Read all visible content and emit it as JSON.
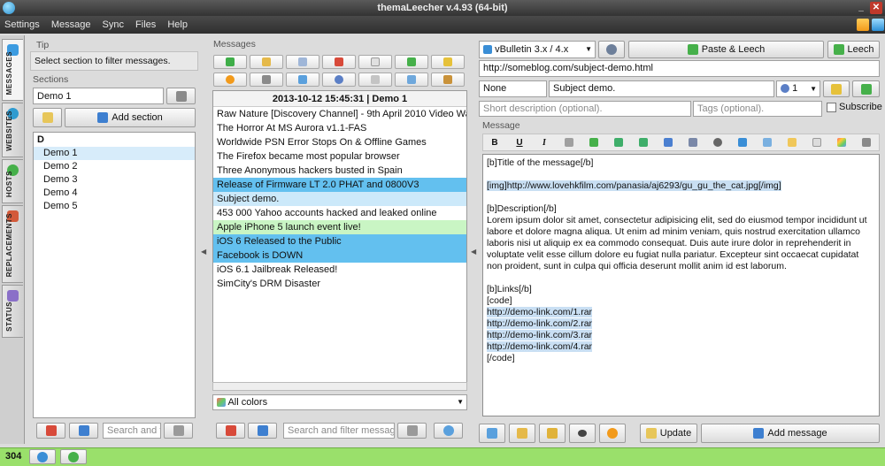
{
  "window": {
    "title": "themaLeecher v.4.93  (64-bit)"
  },
  "menu": [
    "Settings",
    "Message",
    "Sync",
    "Files",
    "Help"
  ],
  "side_tabs": [
    "MESSAGES",
    "WEBSITES",
    "HOSTS",
    "REPLACEMENTS",
    "STATUS"
  ],
  "left": {
    "tip_label": "Tip",
    "tip_text": "Select section to filter messages.",
    "sections_label": "Sections",
    "section_name": "Demo 1",
    "add_section": "Add section",
    "group": "D",
    "items": [
      "Demo 1",
      "Demo 2",
      "Demo 3",
      "Demo 4",
      "Demo 5"
    ],
    "search_placeholder": "Search and fil"
  },
  "messages": {
    "label": "Messages",
    "header": "2013-10-12 15:45:31 | Demo 1",
    "items": [
      {
        "text": "Raw Nature [Discovery Channel] - 9th April 2010 Video Watch Onli",
        "style": ""
      },
      {
        "text": "The Horror At MS Aurora v1.1-FAS",
        "style": ""
      },
      {
        "text": "Worldwide PSN Error Stops On & Offline Games",
        "style": ""
      },
      {
        "text": "The Firefox became most popular browser",
        "style": ""
      },
      {
        "text": "Three Anonymous hackers busted in Spain",
        "style": ""
      },
      {
        "text": "Release of Firmware LT 2.0 PHAT and 0800V3",
        "style": "blue"
      },
      {
        "text": "Subject demo.",
        "style": "light"
      },
      {
        "text": "453 000 Yahoo accounts hacked and leaked online",
        "style": ""
      },
      {
        "text": "Apple iPhone 5 launch event live!",
        "style": "green"
      },
      {
        "text": "iOS 6 Released to the Public",
        "style": "blue"
      },
      {
        "text": "Facebook is DOWN",
        "style": "blue"
      },
      {
        "text": "iOS 6.1 Jailbreak Released!",
        "style": ""
      },
      {
        "text": "SimCity's DRM Disaster",
        "style": ""
      }
    ],
    "color_filter": "All colors",
    "search_placeholder": "Search and filter messages."
  },
  "right": {
    "platform": "vBulletin 3.x / 4.x",
    "paste_leech": "Paste & Leech",
    "leech": "Leech",
    "url": "http://someblog.com/subject-demo.html",
    "prefix": "None",
    "subject": "Subject demo.",
    "count": "1",
    "short_desc_placeholder": "Short description (optional).",
    "tags_placeholder": "Tags (optional).",
    "subscribe": "Subscribe",
    "message_label": "Message",
    "update": "Update",
    "add_message": "Add message",
    "body": {
      "line1": "[b]Title of the message[/b]",
      "line2": "[img]http://www.lovehkfilm.com/panasia/aj6293/gu_gu_the_cat.jpg[/img]",
      "line3": "[b]Description[/b]",
      "para": "Lorem ipsum dolor sit amet, consectetur adipisicing elit, sed do eiusmod tempor incididunt ut labore et dolore magna aliqua. Ut enim ad minim veniam, quis nostrud exercitation ullamco laboris nisi ut aliquip ex ea commodo consequat. Duis aute irure dolor in reprehenderit in voluptate velit esse cillum dolore eu fugiat nulla pariatur. Excepteur sint occaecat cupidatat non proident, sunt in culpa qui officia deserunt mollit anim id est laborum.",
      "line4": "[b]Links[/b]",
      "code_open": "[code]",
      "links": [
        "http://demo-link.com/1.rar",
        "http://demo-link.com/2.rar",
        "http://demo-link.com/3.rar",
        "http://demo-link.com/4.rar"
      ],
      "code_close": "[/code]"
    }
  },
  "status": {
    "count": "304"
  },
  "colors": {
    "accent_blue": "#63c0ef",
    "green": "#9ae06b",
    "dark": "#3a3a3a"
  }
}
